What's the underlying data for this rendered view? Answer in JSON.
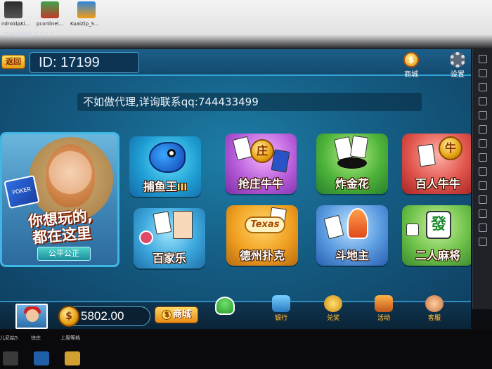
{
  "desktop": {
    "icons": [
      {
        "label": "ndroidдKi..."
      },
      {
        "label": "pconlinel..."
      },
      {
        "label": "KuaiZip_S..."
      }
    ],
    "emulator_title": "夜神模拟器 6.1.1.1"
  },
  "header": {
    "back_label": "返回",
    "id_text": "ID: 17199",
    "shop_label": "商城",
    "settings_label": "设置"
  },
  "notice": "不如做代理,详询联系qq:744433499",
  "promo": {
    "poker_text": "POKER",
    "headline_1": "你想玩的,",
    "headline_2": "都在这里",
    "fair_button": "公平公正"
  },
  "games": [
    {
      "label": "捕鱼王",
      "suffix": "III"
    },
    {
      "label": "抢庄牛牛",
      "coin": "庄"
    },
    {
      "label": "炸金花"
    },
    {
      "label": "百人牛牛",
      "coin": "牛"
    },
    {
      "label": "百家乐"
    },
    {
      "label": "德州扑克",
      "badge": "Texas"
    },
    {
      "label": "斗地主"
    },
    {
      "label": "二人麻将",
      "tile": "發"
    }
  ],
  "footer": {
    "gold": "5802.00",
    "shop_button": "商城",
    "nav": [
      {
        "label": "银行"
      },
      {
        "label": "兑奖"
      },
      {
        "label": "活动"
      },
      {
        "label": "客服"
      }
    ]
  },
  "taskbar": {
    "labels": [
      "儿尼姑5",
      "快庄",
      "上周等档"
    ]
  }
}
